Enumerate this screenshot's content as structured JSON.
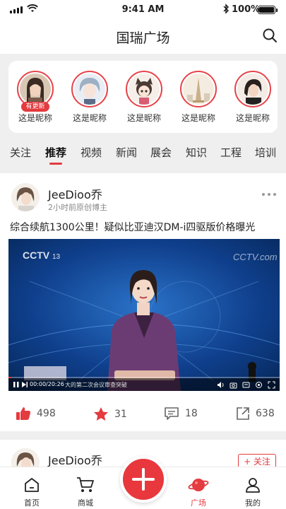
{
  "status_bar": {
    "time": "9:41 AM",
    "battery": "100%"
  },
  "header": {
    "title": "国瑞广场"
  },
  "stories": [
    {
      "name": "这是昵称",
      "badge": "有更新"
    },
    {
      "name": "这是昵称"
    },
    {
      "name": "这是昵称"
    },
    {
      "name": "这是昵称"
    },
    {
      "name": "这是昵称"
    }
  ],
  "tabs": [
    {
      "label": "关注"
    },
    {
      "label": "推荐",
      "active": true
    },
    {
      "label": "视频"
    },
    {
      "label": "新闻"
    },
    {
      "label": "展会"
    },
    {
      "label": "知识"
    },
    {
      "label": "工程"
    },
    {
      "label": "培训"
    }
  ],
  "post": {
    "author": "JeeDioo乔",
    "meta": "2小时前原创博主",
    "title": "综合续航1300公里！疑似比亚迪汉DM-i四驱版价格曝光",
    "video": {
      "channel": "CCTV 13",
      "time": "00:00/20:26",
      "ticker": "大的第二次会议审查突破",
      "progress": 0.01
    },
    "actions": {
      "likes": "498",
      "favorites": "31",
      "comments": "18",
      "shares": "638"
    }
  },
  "post2": {
    "author": "JeeDioo乔",
    "follow_label": "+ 关注"
  },
  "nav": {
    "items": [
      {
        "label": "首页",
        "icon": "home-icon"
      },
      {
        "label": "商城",
        "icon": "cart-icon"
      },
      {
        "label": "广场",
        "icon": "planet-icon",
        "active": true
      },
      {
        "label": "我的",
        "icon": "user-icon"
      }
    ]
  },
  "colors": {
    "accent": "#e33b3f",
    "background": "#efefef"
  }
}
